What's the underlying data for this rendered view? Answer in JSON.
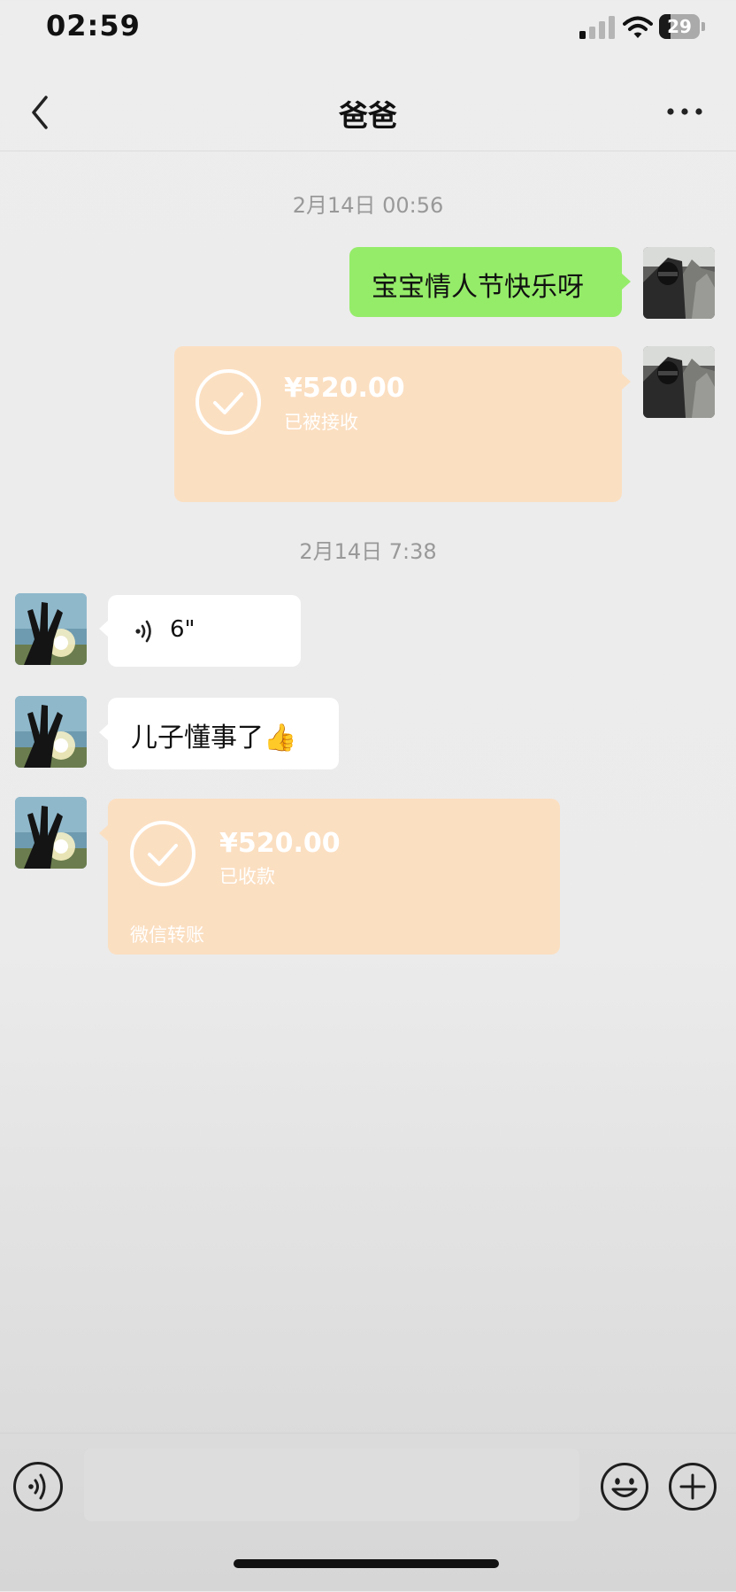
{
  "status_bar": {
    "time": "02:59",
    "battery": "29",
    "battery_level": 0.29
  },
  "header": {
    "title": "爸爸"
  },
  "messages": {
    "ts1": "2月14日 00:56",
    "m1_text": "宝宝情人节快乐呀",
    "t1_amount": "¥520.00",
    "t1_status": "已被接收",
    "ts2": "2月14日 7:38",
    "voice_duration": "6\"",
    "m2_text": "儿子懂事了",
    "m2_emoji": "👍",
    "t2_amount": "¥520.00",
    "t2_status": "已收款",
    "t2_footer": "微信转账"
  },
  "icons": {
    "back": "chevron-left-icon",
    "more": "more-horizontal-icon",
    "voice": "voice-wave-icon",
    "emoji": "smiley-icon",
    "plus": "plus-circle-icon"
  },
  "colors": {
    "my_bubble": "#95ec69",
    "their_bubble": "#ffffff",
    "transfer": "#fbdfc1"
  }
}
